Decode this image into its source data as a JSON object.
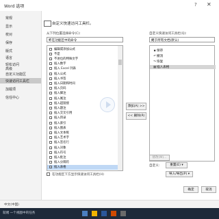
{
  "window": {
    "title": "Word 选项",
    "help_glyph": "?",
    "close_glyph": "✕"
  },
  "sidebar": {
    "items": [
      "常规",
      "显示",
      "校对",
      "保存",
      "版式",
      "语言",
      "轻松访问",
      "高级",
      "",
      "自定义功能区",
      "快速访问工具栏",
      "加载项",
      "信任中心"
    ],
    "selected_index": 10
  },
  "header": {
    "text": "自定义快速访问工具栏。"
  },
  "left": {
    "choose_label": "从下列位置选择命令(C):",
    "choose_value": "不在功能区中的命令",
    "commands": [
      "编辑或添加公式",
      "不是",
      "不进位的特殊文字",
      "插入数字",
      "插入 Excel 列表",
      "插入公式",
      "插入书签",
      "插入日期和时间",
      "插入页码",
      "插入脚注",
      "插入尾注",
      "插入超链接",
      "插入题注",
      "插入交叉引用",
      "插入目录",
      "插入索引",
      "插入图表",
      "插入文本框",
      "插入艺术字",
      "插入签名行",
      "插入对象",
      "插入符号",
      "插入批注",
      "插入分隔符",
      "插入表格"
    ],
    "selected_index": 24,
    "show_below_label": "在功能区下方显示快速访问工具栏(H)"
  },
  "middle": {
    "add_button": "添加(A) >>",
    "remove_button": "<< 删除(R)"
  },
  "right": {
    "customize_label": "自定义快速访问工具栏(Q):",
    "customize_value": "用于所有文档(默认)",
    "items": [
      "保存",
      "撤消",
      "恢复",
      "插入表格"
    ],
    "selected_index": 3,
    "modify_button": "修改(M)...",
    "customizations_label": "自定义:",
    "reset_button": "重置(E) ▾",
    "import_export_button": "导入/导出(P) ▾"
  },
  "footer": {
    "ok_button": "确定",
    "cancel_button": "取消"
  },
  "statusbar": {
    "text": "中文(中国)"
  },
  "taskbar": {
    "status_text": "就绪  一个视图中的任务"
  },
  "colors": {
    "selection": "#bfd8f5",
    "sidebar_sel": "#c9c9c9",
    "taskbar": "#1e2a3a"
  }
}
